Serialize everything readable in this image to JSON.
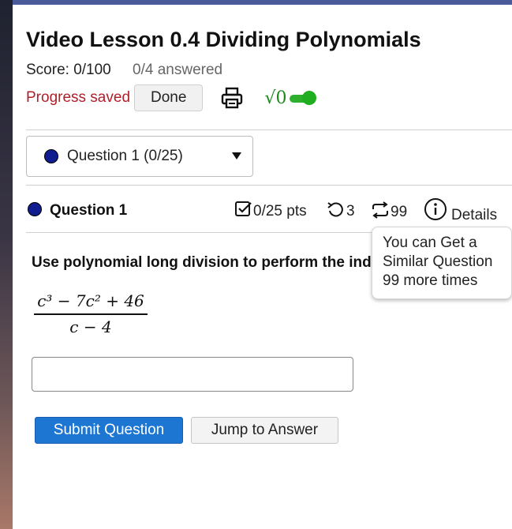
{
  "header": {
    "title": "Video Lesson 0.4 Dividing Polynomials",
    "score": "Score: 0/100",
    "answered": "0/4 answered",
    "progress_saved": "Progress saved",
    "done_label": "Done",
    "sqrt_label": "√0",
    "toggle_on": true
  },
  "question_select": {
    "selected": "Question 1 (0/25)"
  },
  "question": {
    "label": "Question 1",
    "points": "0/25 pts",
    "retries": "3",
    "similar": "99",
    "details_label": "Details",
    "tooltip": "You can Get a Similar Question 99 more times",
    "instructions": "Use polynomial long division to perform the indicated division.",
    "expression": {
      "numerator": "c³ − 7c² + 46",
      "denominator": "c − 4"
    },
    "answer_value": ""
  },
  "actions": {
    "submit_label": "Submit Question",
    "jump_label": "Jump to Answer"
  },
  "icons": [
    "print-icon",
    "checkbox-icon",
    "retry-icon",
    "similar-question-icon",
    "info-icon",
    "caret-down-icon"
  ],
  "colors": {
    "accent": "#1c76d2",
    "progress_saved": "#b0202a",
    "toggle": "#2db02d",
    "topbar": "#4a5b9b",
    "dot": "#0f1d8f"
  }
}
